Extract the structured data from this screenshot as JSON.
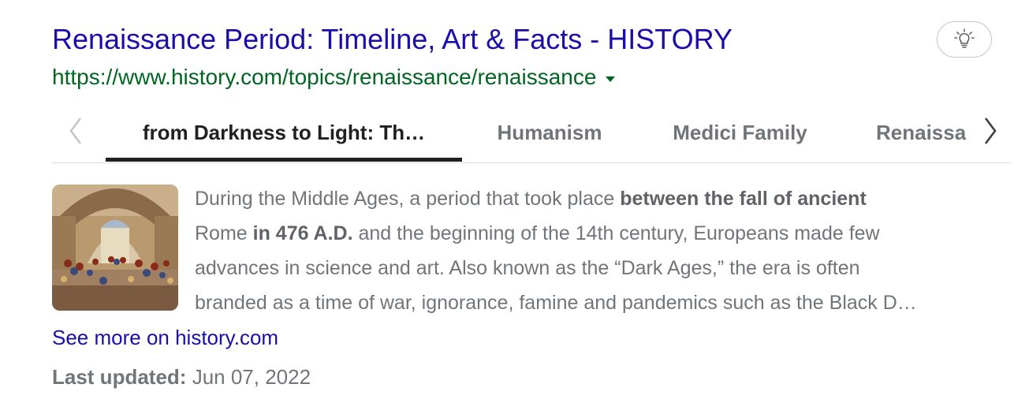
{
  "result": {
    "title": "Renaissance Period: Timeline, Art & Facts - HISTORY",
    "url": "https://www.history.com/topics/renaissance/renaissance"
  },
  "tabs": [
    {
      "label": "from Darkness to Light: Th…",
      "active": true
    },
    {
      "label": "Humanism",
      "active": false
    },
    {
      "label": "Medici Family",
      "active": false
    },
    {
      "label": "Renaissance",
      "active": false
    }
  ],
  "snippet": {
    "l1a": "During the Middle Ages, a period that took place ",
    "l1b": "between the fall of ancient",
    "l2a": "Rome ",
    "l2b": "in 476 A.D.",
    "l2c": " and the beginning of the 14th century, Europeans made few",
    "l3": "advances in science and art. Also known as the “Dark Ages,” the era is often",
    "l4": "branded as a time of war, ignorance, famine and pandemics such as the Black D…"
  },
  "see_more": "See more on history.com",
  "last_updated": {
    "label": "Last updated:",
    "value": "Jun 07, 2022"
  },
  "icons": {
    "feedback": "lightbulb-icon",
    "prev": "chevron-left-icon",
    "next": "chevron-right-icon",
    "url_menu": "caret-down-icon"
  },
  "colors": {
    "link": "#1a0dab",
    "url": "#006621",
    "muted": "#70757a",
    "dark": "#202124"
  }
}
